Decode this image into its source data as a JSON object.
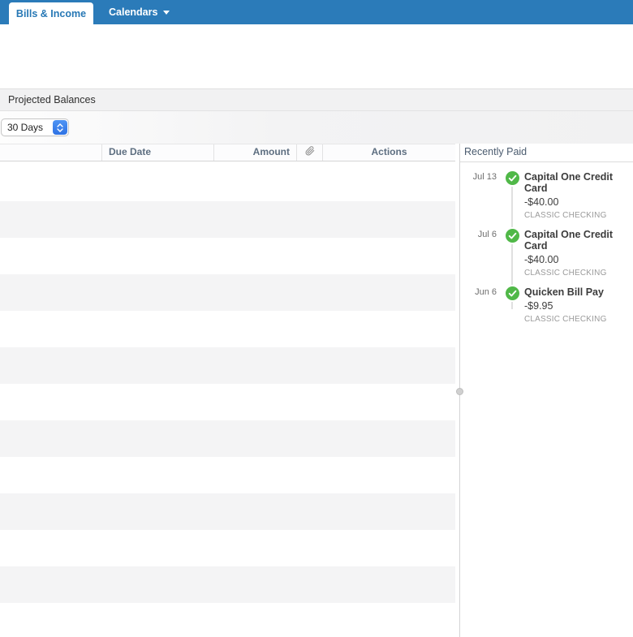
{
  "tabs": [
    {
      "label": "Bills & Income",
      "active": true
    },
    {
      "label": "Calendars",
      "active": false,
      "has_dropdown": true
    }
  ],
  "section_bar": {
    "title": "Projected Balances"
  },
  "filter": {
    "timeframe_selected": "30 Days"
  },
  "bills_table": {
    "headers": {
      "name": "",
      "due_date": "Due Date",
      "amount": "Amount",
      "attachment_icon": "paperclip-icon",
      "actions": "Actions"
    },
    "empty_row_count": 13,
    "rows": []
  },
  "recently_paid": {
    "title": "Recently Paid",
    "items": [
      {
        "date": "Jul 13",
        "status_icon": "paid-check-icon",
        "name": "Capital One Credit Card",
        "amount": "-$40.00",
        "account": "CLASSIC CHECKING"
      },
      {
        "date": "Jul 6",
        "status_icon": "paid-check-icon",
        "name": "Capital One Credit Card",
        "amount": "-$40.00",
        "account": "CLASSIC CHECKING"
      },
      {
        "date": "Jun 6",
        "status_icon": "paid-check-icon",
        "name": "Quicken Bill Pay",
        "amount": "-$9.95",
        "account": "CLASSIC CHECKING"
      }
    ]
  },
  "colors": {
    "tab_bar_blue": "#2b7bb9",
    "active_tab_text_blue": "#2778b5",
    "select_stepper_blue": "#3b82ec",
    "paid_check_green": "#50b848",
    "row_stripe_gray": "#f4f4f5",
    "header_text_gray_blue": "#5d6e80"
  }
}
